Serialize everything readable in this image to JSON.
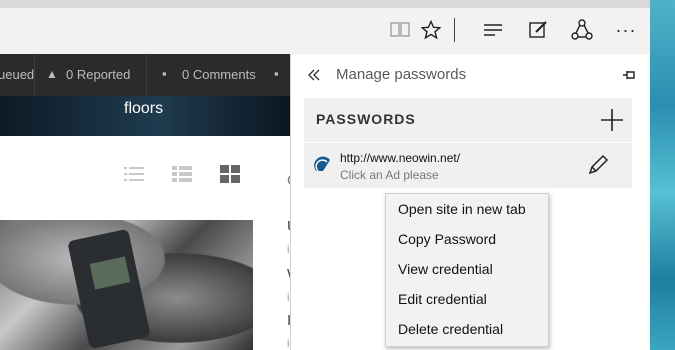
{
  "toolbar": {
    "icons": [
      "reading-view-icon",
      "favorites-star-icon",
      "hub-icon",
      "web-note-icon",
      "share-icon",
      "more-icon"
    ],
    "more_label": "···"
  },
  "site_nav": {
    "queued_label": "ueued",
    "reported_label": "0 Reported",
    "comments_label": "0 Comments"
  },
  "banner": {
    "title": "floors"
  },
  "side_letters": [
    "C",
    "U",
    "i",
    "W",
    "i",
    "I",
    "i"
  ],
  "hub": {
    "title": "Manage passwords",
    "section_title": "PASSWORDS",
    "entries": [
      {
        "url": "http://www.neowin.net/",
        "user": "Click an Ad please"
      }
    ]
  },
  "context_menu": {
    "items": [
      "Open site in new tab",
      "Copy Password",
      "View credential",
      "Edit credential",
      "Delete credential"
    ]
  },
  "colors": {
    "nav_bg": "#2b2b2b",
    "panel_bg": "#f0f0f0",
    "accent_favicon": "#1a5a8a"
  }
}
